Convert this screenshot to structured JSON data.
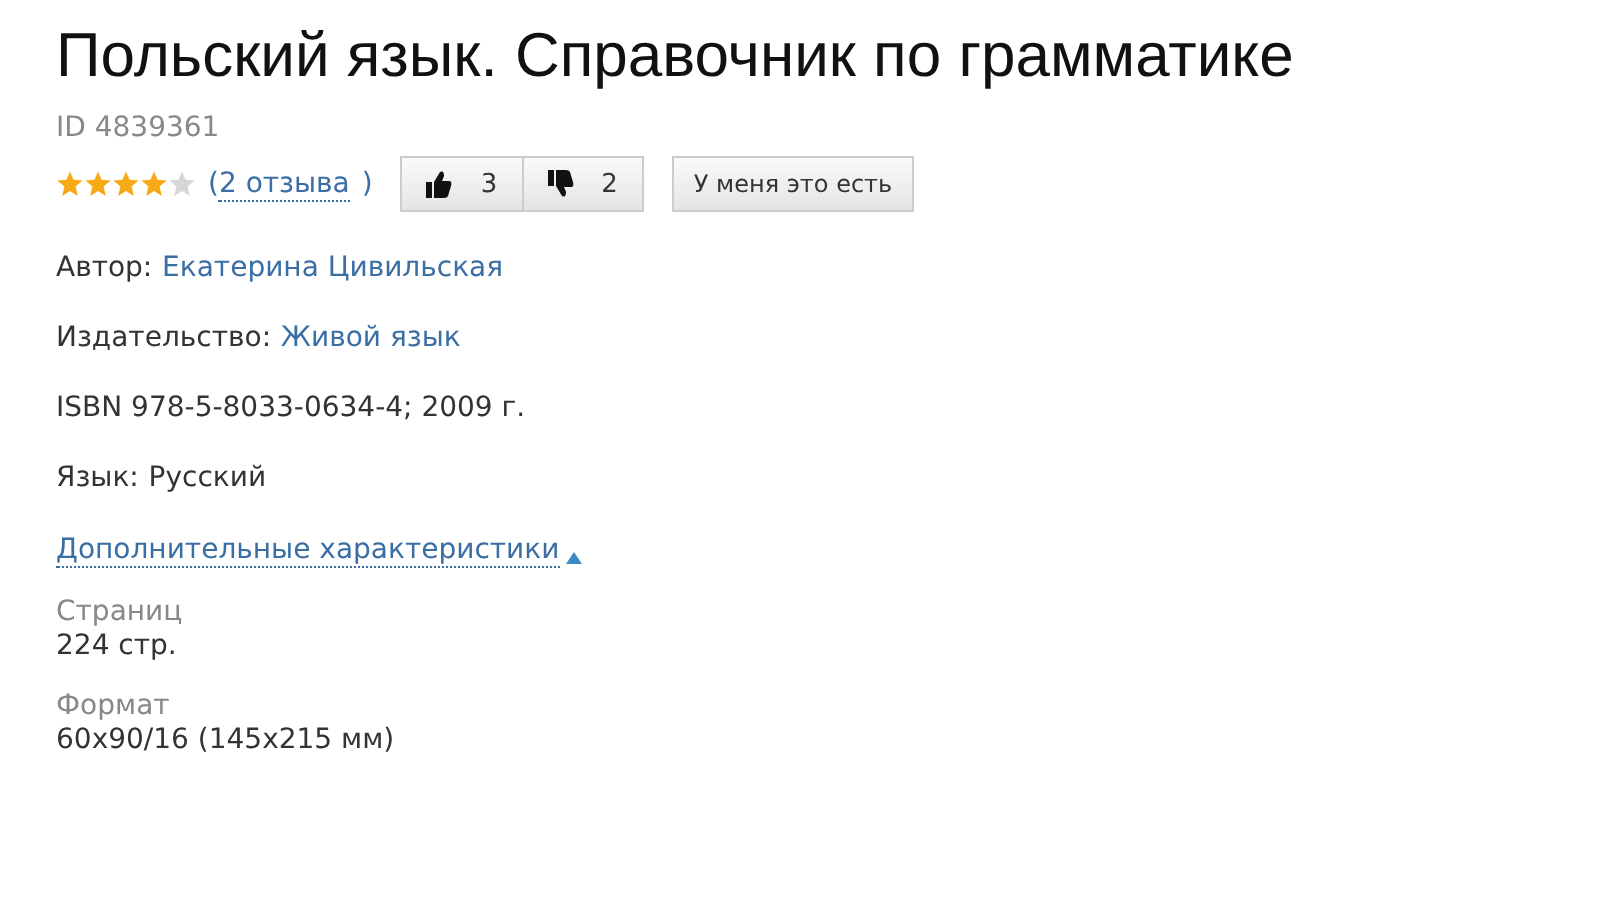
{
  "title": "Польский язык. Справочник по грамматике",
  "id_text": "ID 4839361",
  "rating": {
    "stars": 4,
    "open": "(",
    "reviews_link": "2 отзыва",
    "close": ")"
  },
  "votes": [
    {
      "kind": "up",
      "count": "3"
    },
    {
      "kind": "down",
      "count": "2"
    }
  ],
  "have_button": "У меня это есть",
  "fields": [
    {
      "kind": "link",
      "label": "Автор:",
      "value": "Екатерина Цивильская"
    },
    {
      "kind": "link",
      "label": "Издательство:",
      "value": "Живой язык"
    },
    {
      "kind": "plain",
      "text": "ISBN 978-5-8033-0634-4; 2009 г."
    },
    {
      "kind": "text",
      "label": "Язык:",
      "value": "Русский"
    }
  ],
  "more": {
    "label": "Дополнительные характеристики",
    "expanded": true
  },
  "specs": [
    {
      "name": "Страниц",
      "value": "224 стр."
    },
    {
      "name": "Формат",
      "value": "60x90/16 (145x215 мм)"
    }
  ]
}
